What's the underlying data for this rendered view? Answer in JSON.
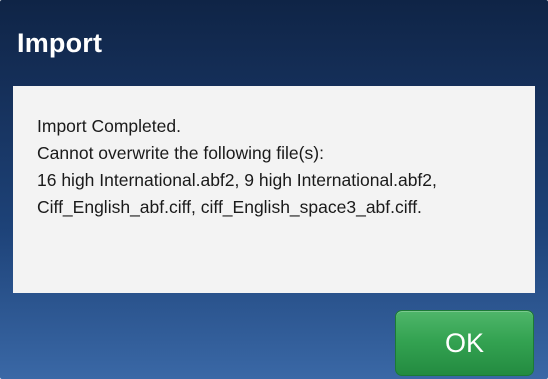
{
  "dialog": {
    "title": "Import",
    "message_lines": [
      "Import Completed.",
      "Cannot overwrite the following file(s):",
      "16 high International.abf2, 9 high International.abf2,",
      "Ciff_English_abf.ciff, ciff_English_space3_abf.ciff."
    ],
    "ok_label": "OK"
  },
  "colors": {
    "title_bar": "#0f2446",
    "panel_background": "#f3f3f3",
    "ok_button": "#34a352"
  }
}
